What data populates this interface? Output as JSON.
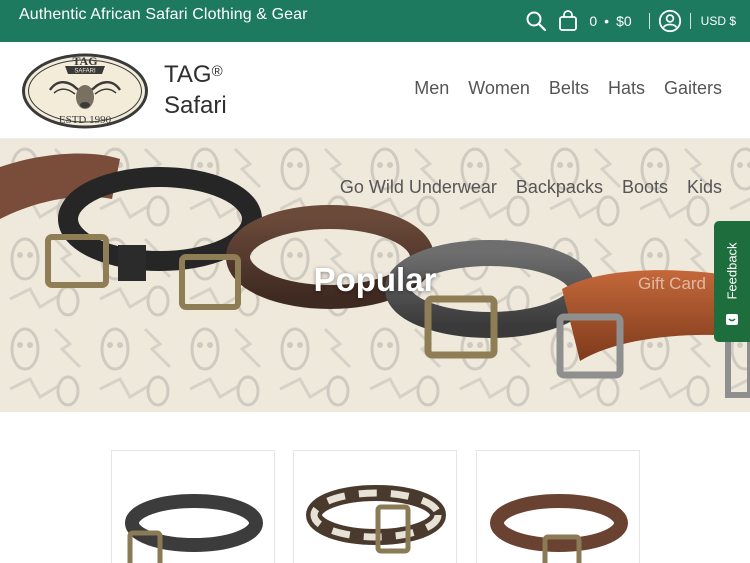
{
  "announcement": {
    "text": "Authentic African Safari Clothing & Gear"
  },
  "cart": {
    "count": "0",
    "separator": "•",
    "total": "$0"
  },
  "currency": {
    "label": "USD $"
  },
  "logo": {
    "top_text": "TAG",
    "banner_text": "SAFARI",
    "bottom_text": "ESTD 1990"
  },
  "brand": {
    "name_line1": "TAG",
    "registered": "®",
    "name_line2": "Safari"
  },
  "nav": {
    "primary": [
      "Men",
      "Women",
      "Belts",
      "Hats",
      "Gaiters"
    ],
    "secondary": [
      "Go Wild Underwear",
      "Backpacks",
      "Boots",
      "Kids"
    ],
    "hidden_item": "Gift Card"
  },
  "hero": {
    "title": "Popular"
  },
  "feedback": {
    "label": "Feedback"
  },
  "products": [
    {
      "name": "belt-black"
    },
    {
      "name": "belt-hide"
    },
    {
      "name": "belt-brown"
    }
  ],
  "icons": [
    "search-icon",
    "cart-icon",
    "account-icon",
    "feedback-icon"
  ],
  "colors": {
    "topbar": "#1d7a5e",
    "feedback": "#1d6e3c",
    "hero_bg": "#efe9dc"
  }
}
